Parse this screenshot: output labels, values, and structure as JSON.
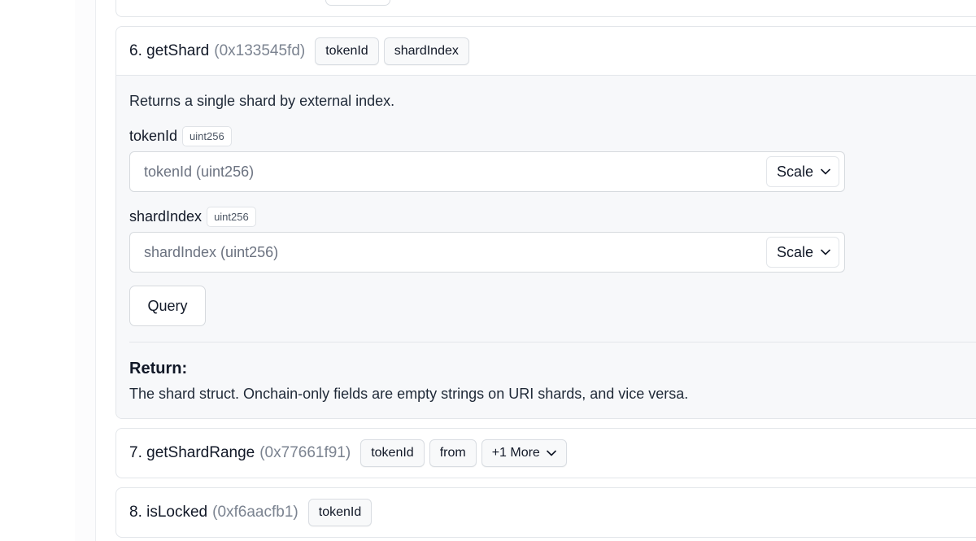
{
  "functions": [
    {
      "title": "6. getShard",
      "selector": "(0x133545fd)",
      "chips": [
        "tokenId",
        "shardIndex"
      ],
      "description": "Returns a single shard by external index.",
      "params": [
        {
          "name": "tokenId",
          "type": "uint256",
          "placeholder": "tokenId (uint256)",
          "scale": "Scale"
        },
        {
          "name": "shardIndex",
          "type": "uint256",
          "placeholder": "shardIndex (uint256)",
          "scale": "Scale"
        }
      ],
      "query_label": "Query",
      "return_title": "Return:",
      "return_desc": "The shard struct. Onchain-only fields are empty strings on URI shards, and vice versa."
    },
    {
      "title": "7. getShardRange",
      "selector": "(0x77661f91)",
      "chips": [
        "tokenId",
        "from"
      ],
      "more_label": "+1 More"
    },
    {
      "title": "8. isLocked",
      "selector": "(0xf6aacfb1)",
      "chips": [
        "tokenId"
      ]
    }
  ],
  "icons": {
    "chevron": "chevron-down-icon"
  }
}
